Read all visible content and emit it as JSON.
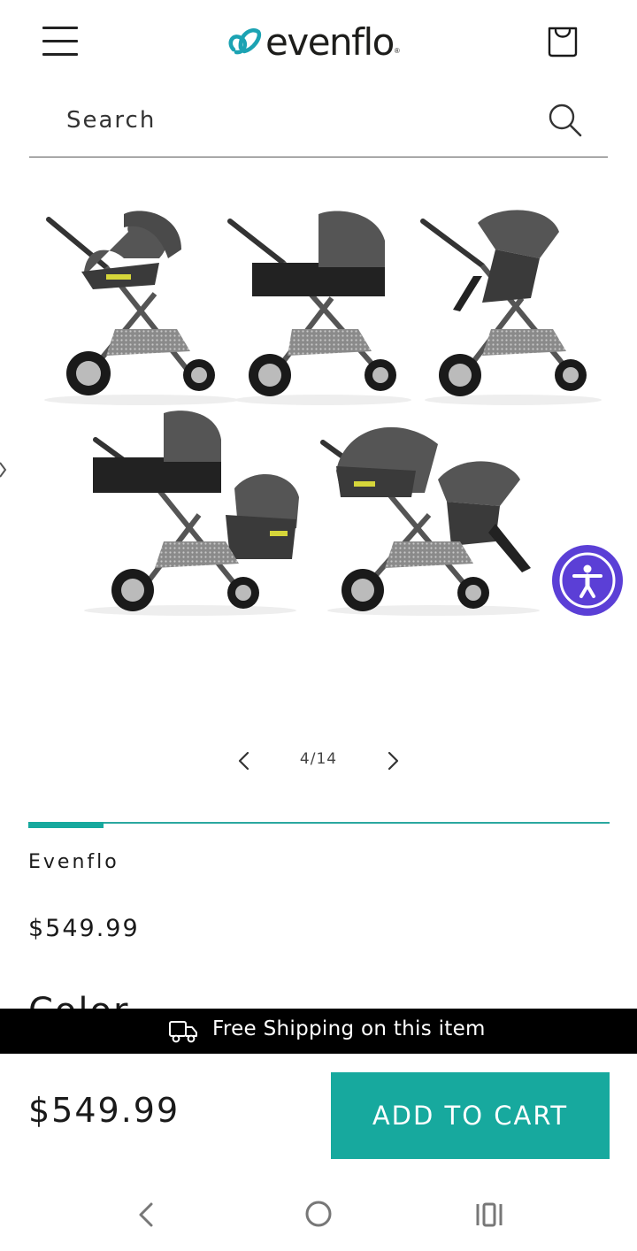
{
  "header": {
    "brand": "evenflo",
    "brand_mark": "®",
    "menu_icon": "hamburger-menu-icon",
    "cart_icon": "shopping-bag-icon",
    "brand_color": "#1ca3b3"
  },
  "search": {
    "placeholder": "Search",
    "icon": "search-icon"
  },
  "gallery": {
    "image_alt": "Evenflo Pivot Xpand modular stroller shown in multiple configurations",
    "counter": "4/14",
    "progress": 0.13,
    "prev_icon": "chevron-left-icon",
    "next_icon": "chevron-right-icon"
  },
  "accessibility": {
    "icon": "accessibility-icon",
    "color": "#5b3fd6"
  },
  "product": {
    "vendor": "Evenflo",
    "price": "$549.99",
    "next_section_peek": "Color"
  },
  "shipping_bar": {
    "icon": "delivery-truck-icon",
    "text": "Free Shipping on this item"
  },
  "sticky": {
    "price": "$549.99",
    "add_to_cart_label": "ADD TO CART",
    "accent_color": "#17a99e"
  },
  "system_nav": {
    "back_icon": "back-chevron-icon",
    "home_icon": "home-circle-icon",
    "recents_icon": "recent-apps-icon"
  }
}
